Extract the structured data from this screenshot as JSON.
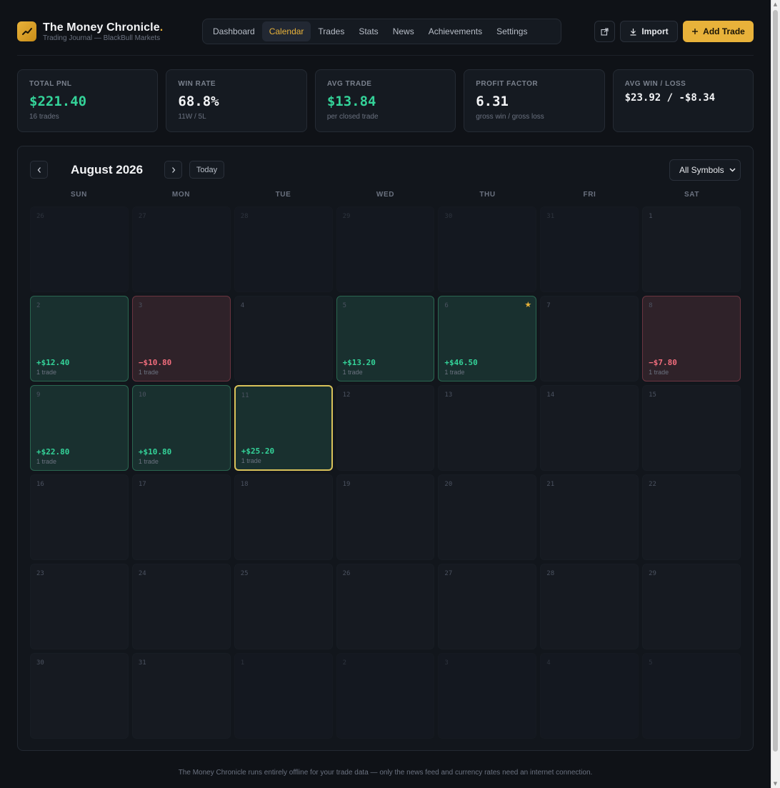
{
  "app": {
    "title": "The Money Chronicle",
    "title_dot": ".",
    "subtitle": "Trading Journal — BlackBull Markets",
    "logo_icon": "trend-up-icon"
  },
  "nav": {
    "items": [
      {
        "label": "Dashboard",
        "active": false
      },
      {
        "label": "Calendar",
        "active": true
      },
      {
        "label": "Trades",
        "active": false
      },
      {
        "label": "Stats",
        "active": false
      },
      {
        "label": "News",
        "active": false
      },
      {
        "label": "Achievements",
        "active": false
      },
      {
        "label": "Settings",
        "active": false
      }
    ]
  },
  "actions": {
    "external_icon": "external-link-icon",
    "import_label": "Import",
    "add_trade_label": "Add Trade"
  },
  "stats": [
    {
      "label": "TOTAL PNL",
      "value": "$221.40",
      "sub": "16 trades",
      "tone": "green"
    },
    {
      "label": "WIN RATE",
      "value": "68.8%",
      "sub": "11W / 5L",
      "tone": "white"
    },
    {
      "label": "AVG TRADE",
      "value": "$13.84",
      "sub": "per closed trade",
      "tone": "green"
    },
    {
      "label": "PROFIT FACTOR",
      "value": "6.31",
      "sub": "gross win / gross loss",
      "tone": "white"
    },
    {
      "label": "AVG WIN / LOSS",
      "value": "$23.92 / -$8.34",
      "sub": "",
      "tone": "white-small"
    }
  ],
  "calendar": {
    "month_label": "August 2026",
    "today_label": "Today",
    "symbol_filter": "All Symbols",
    "weekdays": [
      "SUN",
      "MON",
      "TUE",
      "WED",
      "THU",
      "FRI",
      "SAT"
    ],
    "days": [
      {
        "num": "26",
        "outside": true
      },
      {
        "num": "27",
        "outside": true
      },
      {
        "num": "28",
        "outside": true
      },
      {
        "num": "29",
        "outside": true
      },
      {
        "num": "30",
        "outside": true
      },
      {
        "num": "31",
        "outside": true
      },
      {
        "num": "1"
      },
      {
        "num": "2",
        "pnl": "+$12.40",
        "trades": "1 trade",
        "result": "win"
      },
      {
        "num": "3",
        "pnl": "−$10.80",
        "trades": "1 trade",
        "result": "loss"
      },
      {
        "num": "4"
      },
      {
        "num": "5",
        "pnl": "+$13.20",
        "trades": "1 trade",
        "result": "win"
      },
      {
        "num": "6",
        "pnl": "+$46.50",
        "trades": "1 trade",
        "result": "win",
        "starred": true
      },
      {
        "num": "7"
      },
      {
        "num": "8",
        "pnl": "−$7.80",
        "trades": "1 trade",
        "result": "loss"
      },
      {
        "num": "9",
        "pnl": "+$22.80",
        "trades": "1 trade",
        "result": "win"
      },
      {
        "num": "10",
        "pnl": "+$10.80",
        "trades": "1 trade",
        "result": "win"
      },
      {
        "num": "11",
        "pnl": "+$25.20",
        "trades": "1 trade",
        "result": "win",
        "today": true
      },
      {
        "num": "12"
      },
      {
        "num": "13"
      },
      {
        "num": "14"
      },
      {
        "num": "15"
      },
      {
        "num": "16"
      },
      {
        "num": "17"
      },
      {
        "num": "18"
      },
      {
        "num": "19"
      },
      {
        "num": "20"
      },
      {
        "num": "21"
      },
      {
        "num": "22"
      },
      {
        "num": "23"
      },
      {
        "num": "24"
      },
      {
        "num": "25"
      },
      {
        "num": "26"
      },
      {
        "num": "27"
      },
      {
        "num": "28"
      },
      {
        "num": "29"
      },
      {
        "num": "30"
      },
      {
        "num": "31"
      },
      {
        "num": "1",
        "outside": true
      },
      {
        "num": "2",
        "outside": true
      },
      {
        "num": "3",
        "outside": true
      },
      {
        "num": "4",
        "outside": true
      },
      {
        "num": "5",
        "outside": true
      }
    ]
  },
  "footer": "The Money Chronicle runs entirely offline for your trade data — only the news feed and currency rates need an internet connection.",
  "colors": {
    "accent": "#e8b23a",
    "win": "#34d399",
    "loss": "#f26d7d",
    "background": "#0f1217"
  }
}
